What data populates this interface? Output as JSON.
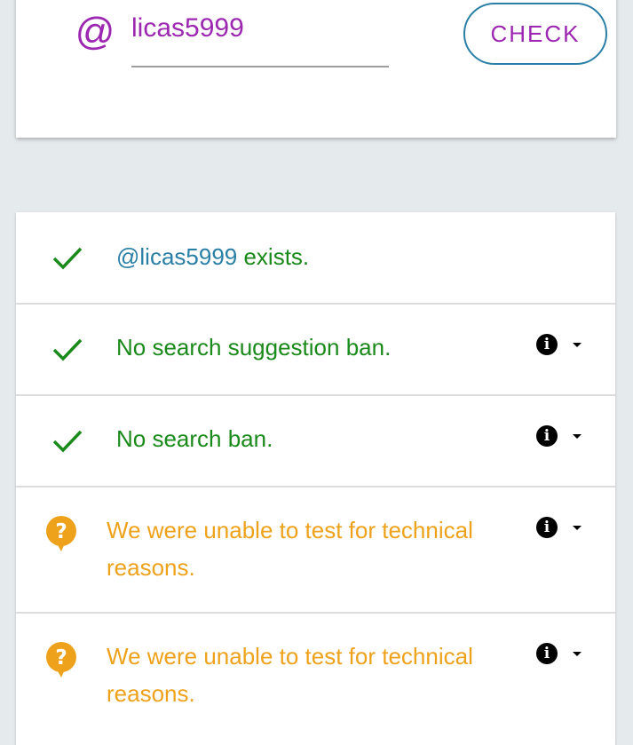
{
  "search": {
    "at_symbol": "@",
    "username": "licas5999",
    "check_label": "CHECK"
  },
  "results": {
    "exists": {
      "username": "@licas5999",
      "suffix": " exists."
    },
    "suggestion_ban": {
      "text": "No search suggestion ban."
    },
    "search_ban": {
      "text": "No search ban."
    },
    "ghost_ban": {
      "text": "We were unable to test for technical reasons."
    },
    "reply_deboosting": {
      "text": "We were unable to test for technical reasons."
    }
  },
  "icons": {
    "status_ok": "check-icon",
    "status_unknown": "question-icon",
    "info": "info-icon",
    "expand": "caret-down-icon",
    "info_glyph": "i",
    "unknown_glyph": "?"
  },
  "colors": {
    "accent_purple": "#9c27b0",
    "link_blue": "#2a7fa6",
    "ok_green": "#1a8a1a",
    "warn_amber": "#eea21b"
  }
}
